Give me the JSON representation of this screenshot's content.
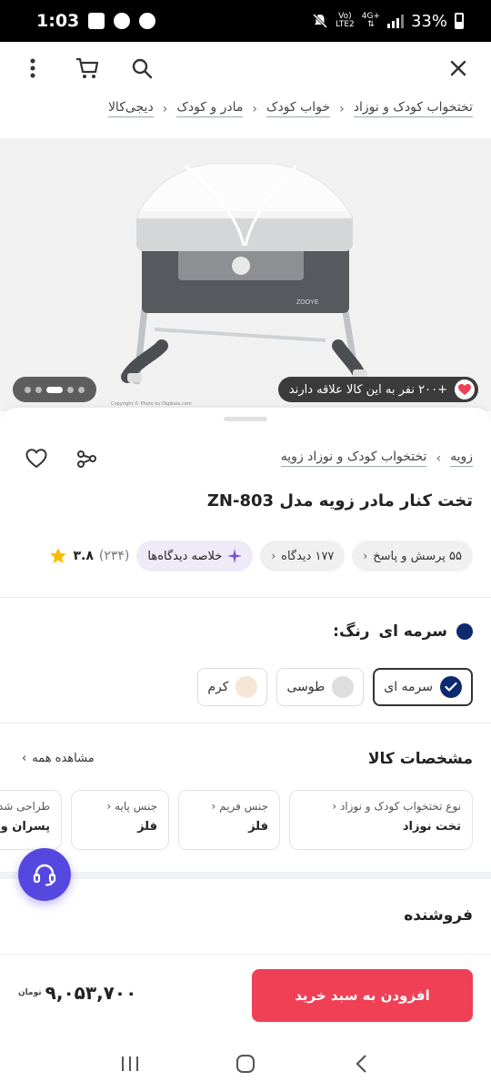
{
  "status_bar": {
    "time": "1:03",
    "network_top": "Vo)",
    "network_bottom": "LTE2",
    "data_type": "4G+",
    "battery": "33%"
  },
  "breadcrumb": {
    "items": [
      "دیجی‌کالا",
      "مادر و کودک",
      "خواب کودک",
      "تختخواب کودک و نوزاد"
    ]
  },
  "hero": {
    "likes_text": "+۲۰۰ نفر به این کالا علاقه دارند",
    "copyright": "Copyright © Photo by Digikala.com",
    "image_count": 5,
    "active_image": 2
  },
  "product": {
    "brand": "زویه",
    "category": "تختخواب کودک و نوزاد زویه",
    "title": "تخت کنار مادر زویه مدل ZN-803",
    "rating": "۳.۸",
    "rating_count": "(۲۳۴)",
    "summary_chip": "خلاصه دیدگاه‌ها",
    "views_chip": "۱۷۷ دیدگاه",
    "questions_chip": "۵۵ پرسش و پاسخ"
  },
  "color": {
    "label": "رنگ:",
    "selected": "سرمه ای",
    "selected_hex": "#0e2a6e",
    "options": [
      {
        "name": "سرمه ای",
        "hex": "#0e2a6e"
      },
      {
        "name": "طوسی",
        "hex": "#dedede"
      },
      {
        "name": "کرم",
        "hex": "#f6e6d5"
      }
    ]
  },
  "specs": {
    "title": "مشخصات کالا",
    "see_all": "مشاهده همه",
    "cards": [
      {
        "key": "نوع تختخواب کودک و نوزاد",
        "value": "تخت نوزاد"
      },
      {
        "key": "جنس فریم",
        "value": "فلز"
      },
      {
        "key": "جنس پایه",
        "value": "فلز"
      },
      {
        "key": "طراحی شده برای",
        "value": "پسران و دختران"
      }
    ]
  },
  "seller": {
    "title": "فروشنده"
  },
  "buy": {
    "button": "افزودن به سبد خرید",
    "price": "۹,۰۵۳,۷۰۰",
    "currency": "تومان"
  },
  "colors": {
    "accent": "#ef4056",
    "support": "#5548e0"
  }
}
